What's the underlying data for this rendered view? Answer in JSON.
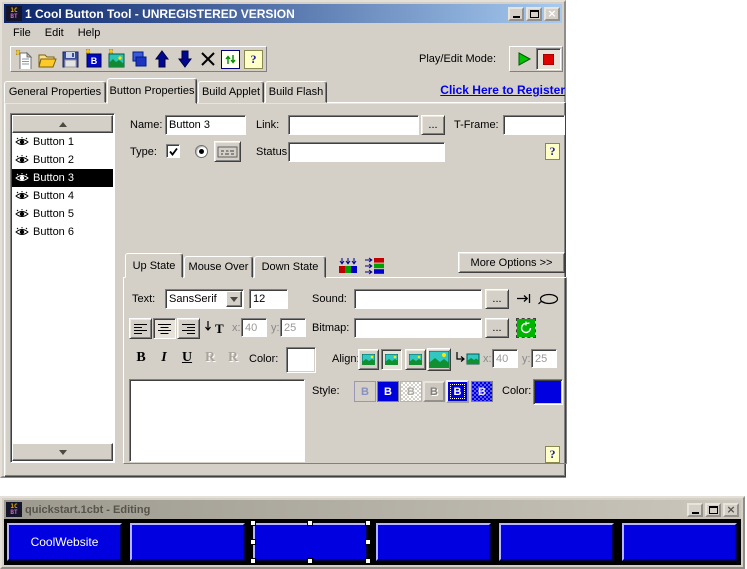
{
  "glyphs": {
    "question": "?",
    "ellipsis": "...",
    "close": "×",
    "icon_top": "1C",
    "icon_bottom": "BT"
  },
  "colors": {
    "accent_blue": "#0000e0",
    "titlebar_from": "#0a246a",
    "titlebar_to": "#a6caf0",
    "selection": "#000000",
    "help_yellow": "#ffffc8"
  },
  "main_window": {
    "title": "1 Cool Button Tool - UNREGISTERED VERSION",
    "menu": {
      "file": "File",
      "edit": "Edit",
      "help": "Help"
    },
    "toolbar": {
      "play_edit_label": "Play/Edit Mode:",
      "icons": [
        "new",
        "open",
        "save",
        "add-button",
        "add-image",
        "duplicate",
        "move-up",
        "move-down",
        "delete",
        "preview",
        "help"
      ]
    },
    "tabs": {
      "general": "General Properties",
      "button": "Button Properties",
      "applet": "Build Applet",
      "flash": "Build Flash"
    },
    "register_link": "Click Here to Register",
    "button_list": {
      "items": [
        "Button 1",
        "Button 2",
        "Button 3",
        "Button 4",
        "Button 5",
        "Button 6"
      ],
      "selected": "Button 3"
    },
    "form": {
      "name_label": "Name:",
      "name_value": "Button 3",
      "link_label": "Link:",
      "link_value": "",
      "tframe_label": "T-Frame:",
      "tframe_value": "",
      "type_label": "Type:",
      "status_label": "Status:",
      "status_value": ""
    },
    "state_tabs": {
      "up": "Up State",
      "over": "Mouse Over",
      "down": "Down State"
    },
    "more_options_label": "More Options >>",
    "state": {
      "text_label": "Text:",
      "font_name": "SansSerif",
      "font_size": "12",
      "sound_label": "Sound:",
      "sound_value": "",
      "bitmap_label": "Bitmap:",
      "bitmap_value": "",
      "x_label": "x:",
      "y_label": "y:",
      "text_x": "40",
      "text_y": "25",
      "bitmap_x": "40",
      "bitmap_y": "25",
      "format": {
        "bold": "B",
        "italic": "I",
        "underline": "U",
        "relief_a": "R",
        "relief_b": "R"
      },
      "color_label": "Color:",
      "align_label": "Align:",
      "style_label": "Style:",
      "style_letter": "B",
      "style_color_label": "Color:",
      "text_color": "#ffffff",
      "style_color": "#0000e0",
      "button_text_value": ""
    }
  },
  "editor_window": {
    "title": "quickstart.1cbt - Editing",
    "buttons": [
      "CoolWebsite",
      "",
      "",
      "",
      "",
      ""
    ],
    "selected_index": 2,
    "button_color": "#0000e0"
  }
}
